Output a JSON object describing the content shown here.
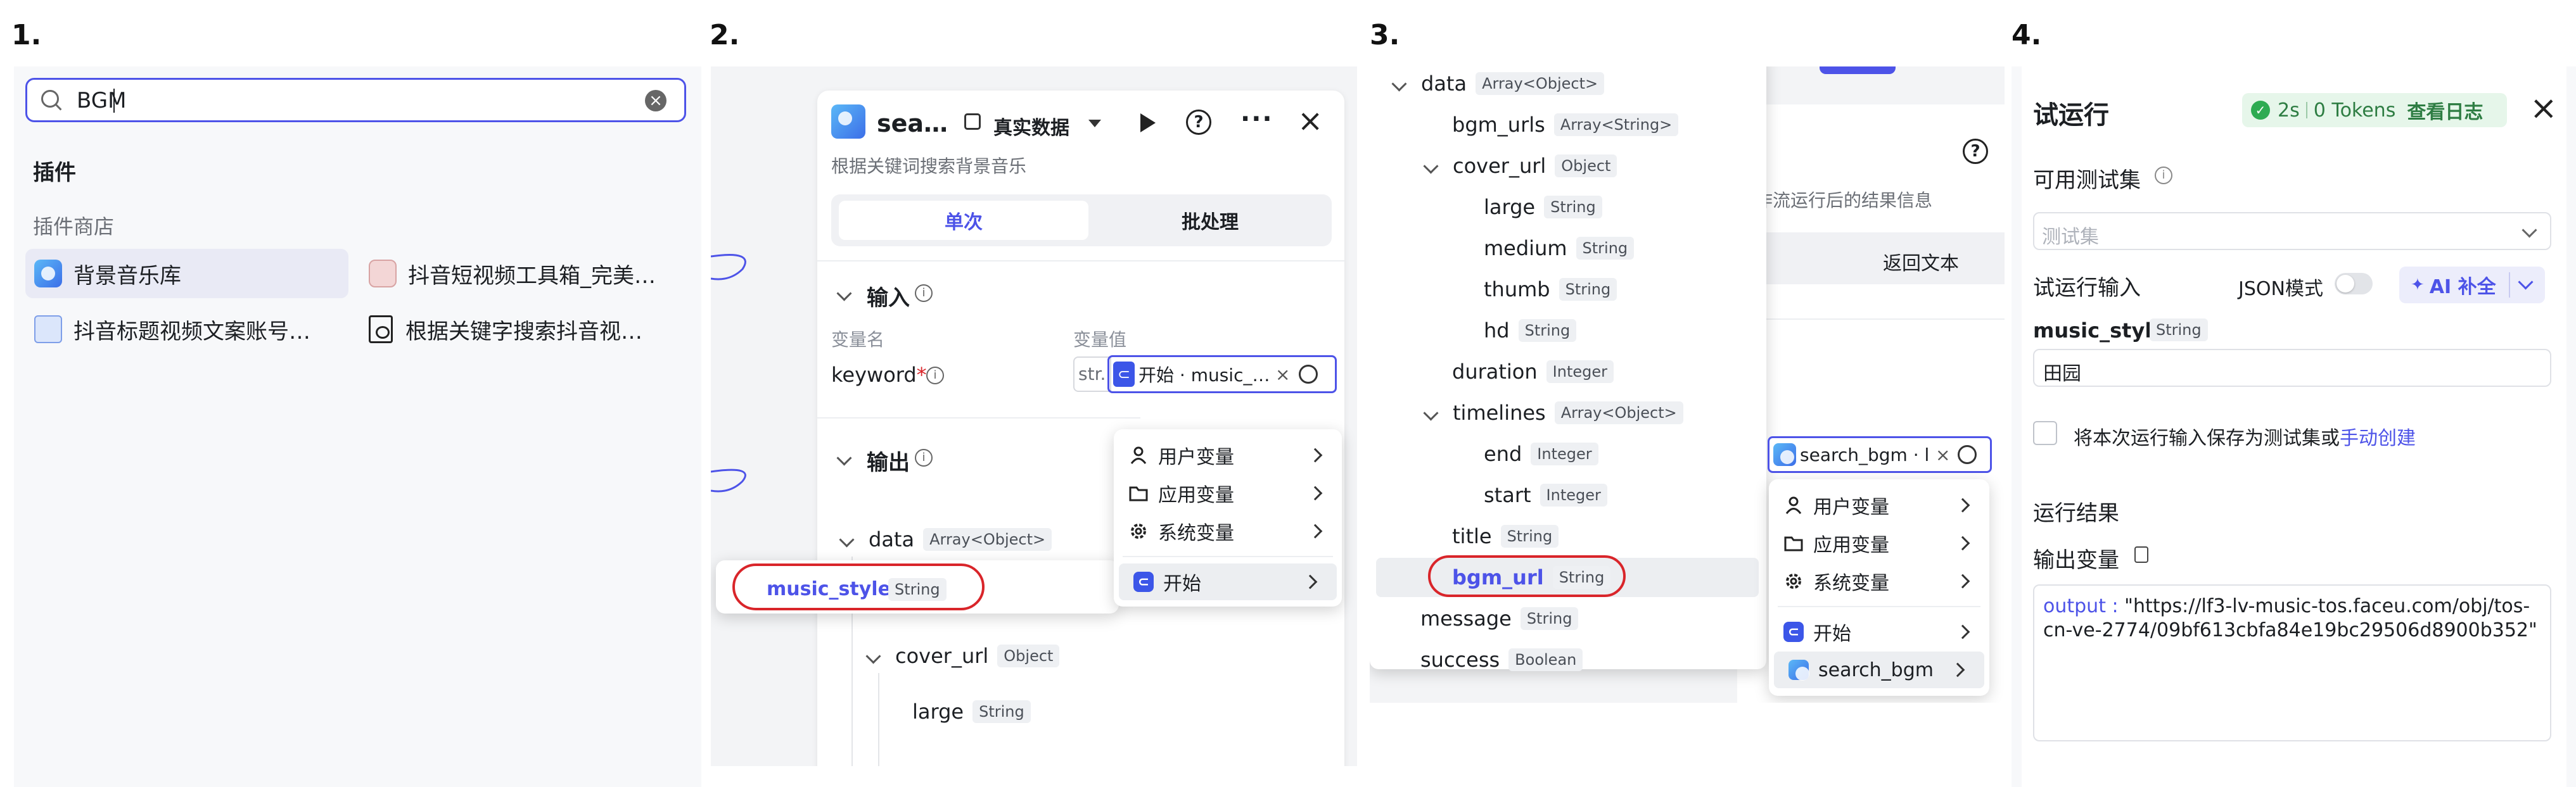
{
  "steps": [
    "1.",
    "2.",
    "3.",
    "4."
  ],
  "panel1": {
    "search_value": "BGM",
    "section_plugins": "插件",
    "section_store": "插件商店",
    "results": [
      "背景音乐库",
      "抖音短视频工具箱_完美…",
      "抖音标题视频文案账号…",
      "根据关键字搜索抖音视…"
    ]
  },
  "panel2": {
    "node_title": "sea…",
    "data_mode": "真实数据",
    "description": "根据关键词搜索背景音乐",
    "tabs": [
      "单次",
      "批处理"
    ],
    "input_section": "输入",
    "col_var_name": "变量名",
    "col_var_value": "变量值",
    "keyword_label": "keyword",
    "required_mark": "*",
    "value_prefix": "str.",
    "value_ref": "开始 · music_…",
    "output_section": "输出",
    "menu": [
      "用户变量",
      "应用变量",
      "系统变量",
      "开始"
    ],
    "suggestion": {
      "name": "music_style",
      "type": "String"
    },
    "tree": [
      {
        "name": "data",
        "type": "Array<Object>"
      },
      {
        "name": "cover_url",
        "type": "Object"
      },
      {
        "name": "large",
        "type": "String"
      }
    ]
  },
  "panel3": {
    "tree": [
      {
        "name": "data",
        "type": "Array<Object>"
      },
      {
        "name": "bgm_urls",
        "type": "Array<String>"
      },
      {
        "name": "cover_url",
        "type": "Object"
      },
      {
        "name": "large",
        "type": "String"
      },
      {
        "name": "medium",
        "type": "String"
      },
      {
        "name": "thumb",
        "type": "String"
      },
      {
        "name": "hd",
        "type": "String"
      },
      {
        "name": "duration",
        "type": "Integer"
      },
      {
        "name": "timelines",
        "type": "Array<Object>"
      },
      {
        "name": "end",
        "type": "Integer"
      },
      {
        "name": "start",
        "type": "Integer"
      },
      {
        "name": "title",
        "type": "String"
      },
      {
        "name": "bgm_url",
        "type": "String"
      },
      {
        "name": "message",
        "type": "String"
      },
      {
        "name": "success",
        "type": "Boolean"
      }
    ],
    "bg_text": "工作流运行后的结果信息",
    "bg_return": "返回文本",
    "value_ref": "search_bgm · l",
    "menu": [
      "用户变量",
      "应用变量",
      "系统变量",
      "开始",
      "search_bgm"
    ]
  },
  "panel4": {
    "title": "试运行",
    "status_time": "2s",
    "status_tokens": "0 Tokens",
    "view_log": "查看日志",
    "test_set_label": "可用测试集",
    "test_set_placeholder": "测试集",
    "run_input_label": "试运行输入",
    "json_mode": "JSON模式",
    "ai_fill": "AI 补全",
    "param_name": "music_style",
    "param_type": "String",
    "param_value": "田园",
    "save_text": "将本次运行输入保存为测试集或",
    "save_link": "手动创建",
    "result_label": "运行结果",
    "output_var_label": "输出变量",
    "output_key": "output :",
    "output_value": "\"https://lf3-lv-music-tos.faceu.com/obj/tos-cn-ve-2774/09bf613cbfa84e19bc29506d8900b352\""
  },
  "colors": {
    "accent": "#4d53e8",
    "highlight_red": "#d9252a",
    "success_green": "#2eab52"
  }
}
